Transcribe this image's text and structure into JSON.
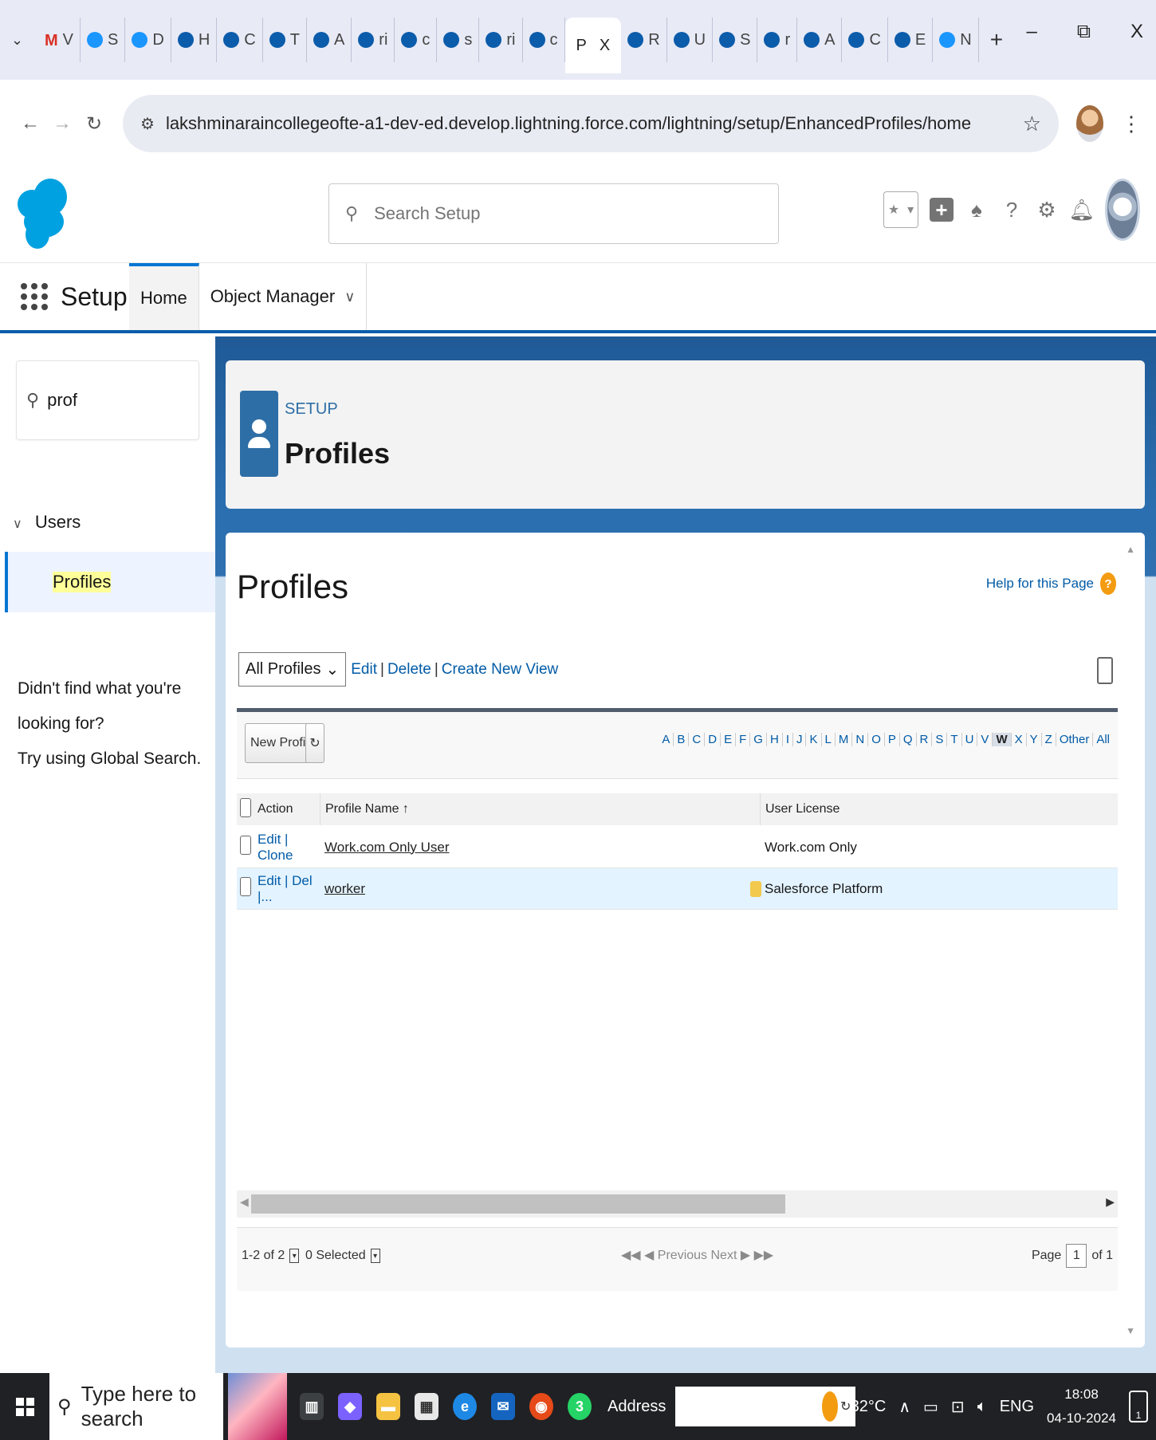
{
  "browser": {
    "tabs": [
      {
        "label": "V",
        "icon": "gmail-icon"
      },
      {
        "label": "S",
        "icon": "document-icon"
      },
      {
        "label": "D",
        "icon": "bolt-icon"
      },
      {
        "label": "H",
        "icon": "salesforce-icon"
      },
      {
        "label": "C",
        "icon": "salesforce-icon"
      },
      {
        "label": "T",
        "icon": "salesforce-icon"
      },
      {
        "label": "A",
        "icon": "salesforce-icon"
      },
      {
        "label": "ri",
        "icon": "salesforce-icon"
      },
      {
        "label": "c",
        "icon": "salesforce-icon"
      },
      {
        "label": "s",
        "icon": "salesforce-icon"
      },
      {
        "label": "ri",
        "icon": "salesforce-icon"
      },
      {
        "label": "c",
        "icon": "salesforce-icon"
      }
    ],
    "active_tab": {
      "label": "P",
      "close": "X"
    },
    "tabs_after": [
      {
        "label": "R",
        "icon": "salesforce-icon"
      },
      {
        "label": "U",
        "icon": "salesforce-icon"
      },
      {
        "label": "S",
        "icon": "salesforce-icon"
      },
      {
        "label": "r",
        "icon": "salesforce-icon"
      },
      {
        "label": "A",
        "icon": "salesforce-icon"
      },
      {
        "label": "C",
        "icon": "salesforce-icon"
      },
      {
        "label": "E",
        "icon": "salesforce-icon"
      },
      {
        "label": "N",
        "icon": "chrome-icon"
      }
    ],
    "new_tab": "+",
    "window_controls": {
      "minimize": "–",
      "restore": "⧉",
      "close": "X"
    },
    "url": "lakshminaraincollegeofte-a1-dev-ed.develop.lightning.force.com/lightning/setup/EnhancedProfiles/home"
  },
  "sf_header": {
    "search_placeholder": "Search Setup",
    "brand_color": "#00a1e0"
  },
  "sf_nav": {
    "app_name": "Setup",
    "tabs": [
      "Home",
      "Object Manager"
    ]
  },
  "sidebar": {
    "quickfind_value": "prof",
    "section": "Users",
    "item": "Profiles",
    "notfound_line1": "Didn't find what you're looking for?",
    "notfound_line2": "Try using Global Search."
  },
  "page_header": {
    "eyebrow": "SETUP",
    "title": "Profiles"
  },
  "content": {
    "title": "Profiles",
    "help_link": "Help for this Page",
    "view_select": "All Profiles",
    "view_links": [
      "Edit",
      "Delete",
      "Create New View"
    ],
    "new_profile_button": "New Profile",
    "alphabet": [
      "A",
      "B",
      "C",
      "D",
      "E",
      "F",
      "G",
      "H",
      "I",
      "J",
      "K",
      "L",
      "M",
      "N",
      "O",
      "P",
      "Q",
      "R",
      "S",
      "T",
      "U",
      "V",
      "W",
      "X",
      "Y",
      "Z",
      "Other",
      "All"
    ],
    "alphabet_selected": "W",
    "columns": {
      "action": "Action",
      "profile_name": "Profile Name ↑",
      "user_license": "User License"
    },
    "rows": [
      {
        "actions": "Edit | Clone",
        "name": "Work.com Only User",
        "license": "Work.com Only",
        "locked": false
      },
      {
        "actions": "Edit | Del |...",
        "name": "worker",
        "license": "Salesforce Platform",
        "locked": true
      }
    ],
    "footer": {
      "range": "1-2 of 2",
      "selected": "0 Selected",
      "pager": "◀◀ ◀ Previous  Next ▶ ▶▶",
      "page_label": "Page",
      "page_value": "1",
      "page_of": "of 1"
    }
  },
  "taskbar": {
    "search_placeholder": "Type here to search",
    "address_label": "Address",
    "weather": "32°C",
    "language": "ENG",
    "time": "18:08",
    "date": "04-10-2024",
    "notifications": "1",
    "whatsapp_badge": "3"
  }
}
